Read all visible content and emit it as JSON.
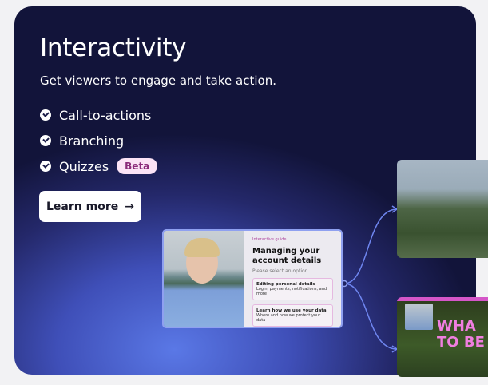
{
  "title": "Interactivity",
  "subtitle": "Get viewers to engage and take action.",
  "features": [
    {
      "label": "Call-to-actions"
    },
    {
      "label": "Branching"
    },
    {
      "label": "Quizzes",
      "badge": "Beta"
    }
  ],
  "cta": {
    "label": "Learn more",
    "icon": "arrow-right-icon"
  },
  "preview": {
    "tag": "Interactive guide",
    "heading": "Managing your account details",
    "prompt": "Please select an option",
    "options": [
      {
        "title": "Editing personal details",
        "desc": "Login, payments, notifications, and more"
      },
      {
        "title": "Learn how we use your data",
        "desc": "Where and how we protect your data"
      }
    ]
  },
  "branch_preview": {
    "headline_1": "WHA",
    "headline_2": "TO BE"
  }
}
